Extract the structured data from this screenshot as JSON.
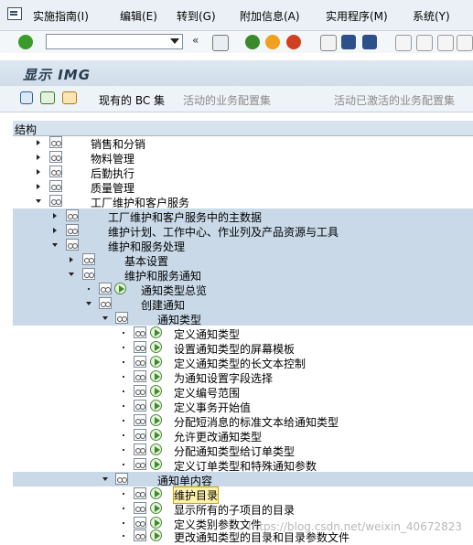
{
  "menu": [
    "实施指南(I)",
    "编辑(E)",
    "转到(G)",
    "附加信息(A)",
    "实用程序(M)",
    "系统(Y)"
  ],
  "command_field": {
    "value": ""
  },
  "title": "显示 IMG",
  "app_toolbar": {
    "existing_bc": "现有的 BC 集",
    "active_bc": "活动的业务配置集",
    "activated_bc": "活动已激活的业务配置集"
  },
  "structure_header": "结构",
  "tree": [
    {
      "label": "销售和分销"
    },
    {
      "label": "物料管理"
    },
    {
      "label": "后勤执行"
    },
    {
      "label": "质量管理"
    },
    {
      "label": "工厂维护和客户服务"
    },
    {
      "label": "工厂维护和客户服务中的主数据"
    },
    {
      "label": "维护计划、工作中心、作业列及产品资源与工具"
    },
    {
      "label": "维护和服务处理"
    },
    {
      "label": "基本设置"
    },
    {
      "label": "维护和服务通知"
    },
    {
      "label": "通知类型总览"
    },
    {
      "label": "创建通知"
    },
    {
      "label": "通知类型"
    },
    {
      "label": "定义通知类型"
    },
    {
      "label": "设置通知类型的屏幕模板"
    },
    {
      "label": "定义通知类型的长文本控制"
    },
    {
      "label": "为通知设置字段选择"
    },
    {
      "label": "定义编号范围"
    },
    {
      "label": "定义事务开始值"
    },
    {
      "label": "分配短消息的标准文本给通知类型"
    },
    {
      "label": "允许更改通知类型"
    },
    {
      "label": "分配通知类型给订单类型"
    },
    {
      "label": "定义订单类型和特殊通知参数"
    },
    {
      "label": "通知单内容"
    },
    {
      "label": "维护目录"
    },
    {
      "label": "显示所有的子项目的目录"
    },
    {
      "label": "定义类别参数文件"
    },
    {
      "label": "更改通知类型的目录和目录参数文件"
    }
  ],
  "watermark": "https://blog.csdn.net/weixin_40672823"
}
